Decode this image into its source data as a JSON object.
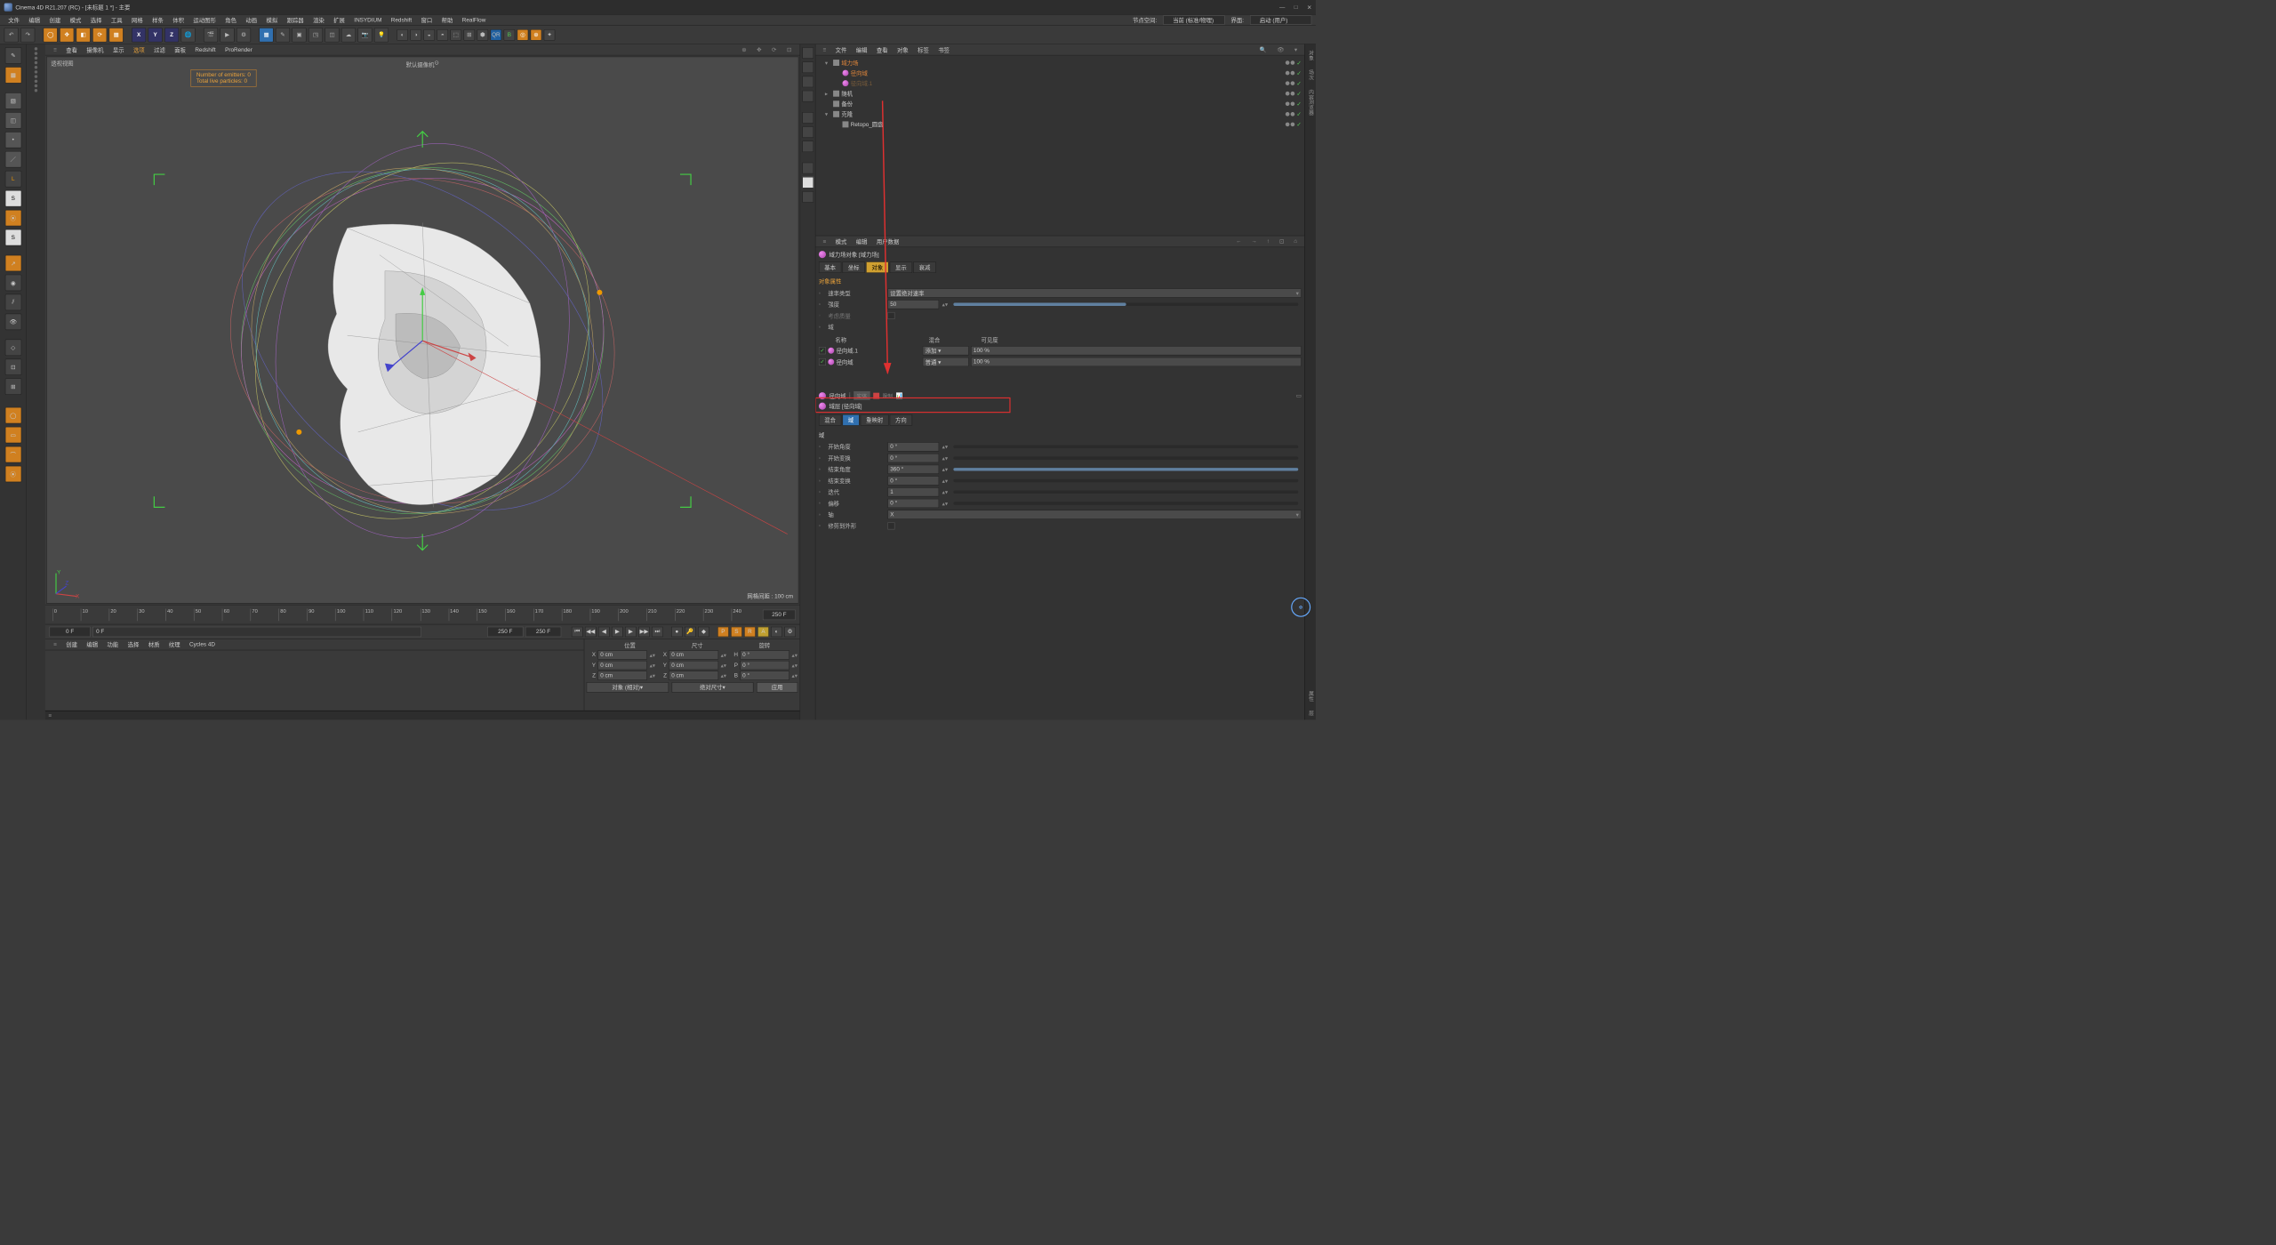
{
  "title": "Cinema 4D R21.207 (RC) - [未标题 1 *] - 主要",
  "mainmenu": [
    "文件",
    "编辑",
    "创建",
    "模式",
    "选择",
    "工具",
    "网格",
    "样条",
    "体积",
    "运动图形",
    "角色",
    "动画",
    "模拟",
    "跟踪器",
    "渲染",
    "扩展",
    "INSYDIUM",
    "Redshift",
    "窗口",
    "帮助",
    "RealFlow"
  ],
  "menu_right": {
    "node_space": "节点空间:",
    "node_space_val": "当前 (标准/物理)",
    "layout": "界面:",
    "layout_val": "启动 (用户)"
  },
  "viewport": {
    "menus": [
      "查看",
      "摄像机",
      "显示",
      "选项",
      "过滤",
      "面板",
      "Redshift",
      "ProRender"
    ],
    "highlight_index": 3,
    "label": "透视视图",
    "camera": "默认摄像机",
    "stats": [
      "Number of emitters: 0",
      "Total live particles: 0"
    ],
    "grid_dist": "网格间距 : 100 cm"
  },
  "timeline": {
    "start": 0,
    "end": 250,
    "frame_end_label": "250 F",
    "cur": "0 F",
    "cur2": "0 F",
    "box_mid1": "250 F",
    "box_mid2": "250 F"
  },
  "bottom_tabs": [
    "创建",
    "编辑",
    "功能",
    "选择",
    "材质",
    "纹理",
    "Cycles 4D"
  ],
  "coords": {
    "heads": [
      "位置",
      "尺寸",
      "旋转"
    ],
    "rows": [
      {
        "axis": "X",
        "p": "0 cm",
        "s": "0 cm",
        "r": "0 °",
        "rlab": "H"
      },
      {
        "axis": "Y",
        "p": "0 cm",
        "s": "0 cm",
        "r": "0 °",
        "rlab": "P"
      },
      {
        "axis": "Z",
        "p": "0 cm",
        "s": "0 cm",
        "r": "0 °",
        "rlab": "B"
      }
    ],
    "mode1": "对象 (相对)",
    "mode2": "绝对尺寸",
    "apply": "应用"
  },
  "objmgr": {
    "menus": [
      "文件",
      "编辑",
      "查看",
      "对象",
      "标签",
      "书签"
    ],
    "tree": [
      {
        "indent": 0,
        "exp": "▾",
        "icon": "force",
        "name": "域力场",
        "cls": "orange"
      },
      {
        "indent": 1,
        "exp": "",
        "icon": "sphere",
        "name": "径向域",
        "cls": "orange"
      },
      {
        "indent": 1,
        "exp": "",
        "icon": "sphere",
        "name": "径向域.1",
        "cls": "dim"
      },
      {
        "indent": 0,
        "exp": "▸",
        "icon": "rand",
        "name": "随机",
        "cls": ""
      },
      {
        "indent": 0,
        "exp": "",
        "icon": "plane",
        "name": "备份",
        "cls": ""
      },
      {
        "indent": 0,
        "exp": "▾",
        "icon": "clone",
        "name": "克隆",
        "cls": ""
      },
      {
        "indent": 1,
        "exp": "",
        "icon": "disc",
        "name": "Retopo_圆盘",
        "cls": ""
      }
    ]
  },
  "attr": {
    "menus": [
      "模式",
      "编辑",
      "用户数据"
    ],
    "obj_title": "域力场对象 [域力场]",
    "tabs1": [
      "基本",
      "坐标",
      "对象",
      "显示",
      "衰减"
    ],
    "tabs1_active": 2,
    "section": "对象属性",
    "rate_type_lab": "速率类型",
    "rate_type_val": "设置绝对速率",
    "strength_lab": "强度",
    "strength_val": "50",
    "mass_lab": "考虑质量",
    "domain_lab": "域",
    "dom_head": [
      "名称",
      "混合",
      "可见度"
    ],
    "dom_rows": [
      {
        "name": "径向域.1",
        "mode": "添加",
        "vis": "100 %"
      },
      {
        "name": "径向域",
        "mode": "普通",
        "vis": "100 %"
      }
    ],
    "layer_title": "径向域",
    "layer_tags": [
      "实体",
      "限制"
    ],
    "layer_sub": "域层 [径向域]",
    "subtabs": [
      "混合",
      "域",
      "重映射",
      "方向"
    ],
    "subtabs_active": 1,
    "sub_section": "域",
    "fields": [
      {
        "lab": "开始角度",
        "val": "0 °"
      },
      {
        "lab": "开始变换",
        "val": "0 °"
      },
      {
        "lab": "结束角度",
        "val": "360 °"
      },
      {
        "lab": "结束变换",
        "val": "0 °"
      },
      {
        "lab": "迭代",
        "val": "1"
      },
      {
        "lab": "偏移",
        "val": "0 °"
      },
      {
        "lab": "轴",
        "val": "X"
      },
      {
        "lab": "修剪到外形",
        "val": ""
      }
    ]
  },
  "win_btns": [
    "—",
    "□",
    "✕"
  ]
}
